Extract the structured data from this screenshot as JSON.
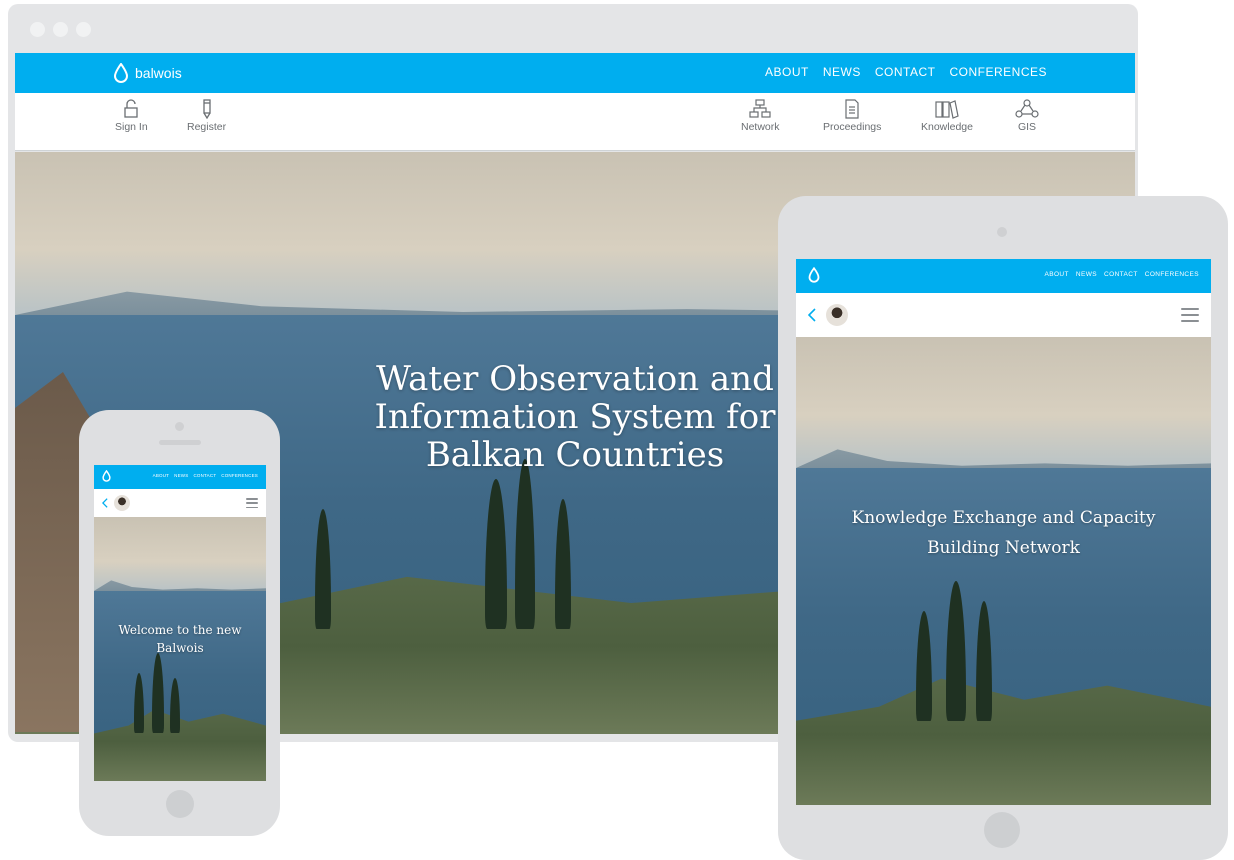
{
  "desktop": {
    "logo_text": "balwois",
    "nav": [
      "ABOUT",
      "NEWS",
      "CONTACT",
      "CONFERENCES"
    ],
    "left_tools": [
      {
        "label": "Sign In",
        "icon": "unlock-icon"
      },
      {
        "label": "Register",
        "icon": "pencil-icon"
      }
    ],
    "right_tools": [
      {
        "label": "Network",
        "icon": "network-icon"
      },
      {
        "label": "Proceedings",
        "icon": "document-icon"
      },
      {
        "label": "Knowledge",
        "icon": "books-icon"
      },
      {
        "label": "GIS",
        "icon": "nodes-icon"
      }
    ],
    "headline_lines": [
      "Water Observation and",
      "Information System for",
      "Balkan Countries"
    ]
  },
  "tablet": {
    "nav": [
      "ABOUT",
      "NEWS",
      "CONTACT",
      "CONFERENCES"
    ],
    "headline_lines": [
      "Knowledge Exchange and Capacity",
      "Building Network"
    ]
  },
  "phone": {
    "nav": [
      "ABOUT",
      "NEWS",
      "CONTACT",
      "CONFERENCES"
    ],
    "headline_lines": [
      "Welcome to the new",
      "Balwois"
    ]
  },
  "colors": {
    "brand_blue": "#00aeef",
    "device_frame": "#dedfe1"
  }
}
